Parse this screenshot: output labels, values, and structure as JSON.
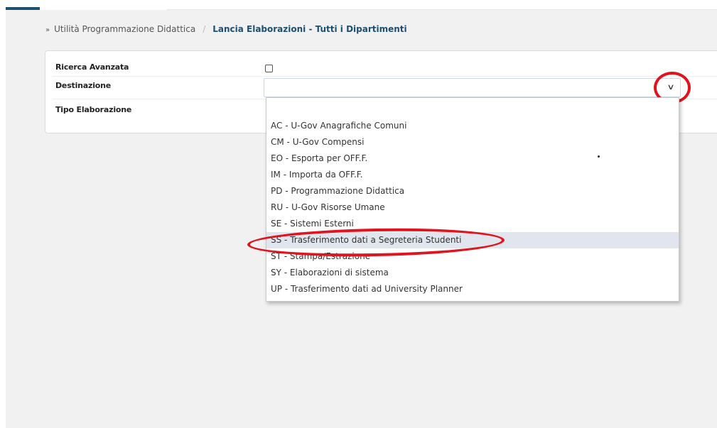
{
  "breadcrumb": {
    "marker": "»",
    "parent": "Utilità Programmazione Didattica",
    "separator": "/",
    "current": "Lancia Elaborazioni - Tutti i Dipartimenti"
  },
  "form": {
    "advanced_search_label": "Ricerca Avanzata",
    "advanced_search_checked": false,
    "destination_label": "Destinazione",
    "destination_value": "",
    "processing_type_label": "Tipo Elaborazione"
  },
  "dropdown": {
    "options": [
      "AC - U-Gov Anagrafiche Comuni",
      "CM - U-Gov Compensi",
      "EO - Esporta per OFF.F.",
      "IM - Importa da OFF.F.",
      "PD - Programmazione Didattica",
      "RU - U-Gov Risorse Umane",
      "SE - Sistemi Esterni",
      "SS - Trasferimento dati a Segreteria Studenti",
      "ST - Stampa/Estrazione",
      "SY - Elaborazioni di sistema",
      "UP - Trasferimento dati ad University Planner"
    ],
    "highlighted_index": 7
  },
  "icons": {
    "select_arrow": "chevron-down-icon",
    "breadcrumb_marker": "double-chevron-right-icon"
  },
  "colors": {
    "accent": "#1f4f6f",
    "annotation_red": "#e0141e",
    "option_highlight": "#e1e6ee"
  }
}
